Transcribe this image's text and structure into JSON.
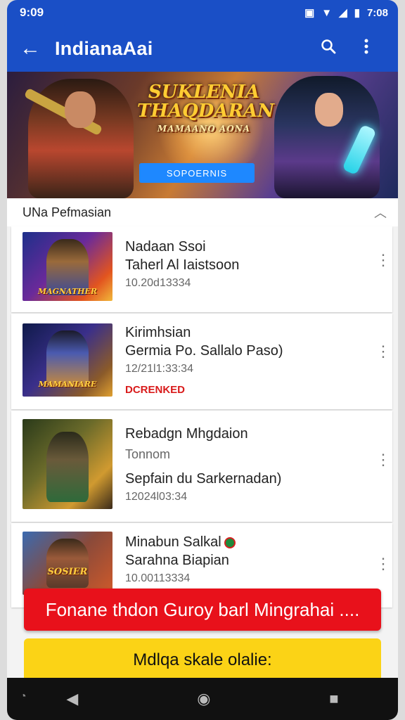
{
  "status_bar": {
    "time_left": "9:09",
    "time_right": "7:08",
    "icons": [
      "sim-icon",
      "wifi-icon",
      "signal-icon",
      "battery-icon"
    ]
  },
  "app_bar": {
    "title": "IndianaAai",
    "back_icon": "arrow-left-icon",
    "search_icon": "search-icon",
    "menu_icon": "more-vert-icon"
  },
  "banner": {
    "title_line1": "SUKLENIA",
    "title_line2": "THAQDARAN",
    "title_line3": "MAMAANO AONA",
    "button_label": "SOPOERNIS"
  },
  "section": {
    "title": "UNa Pefmasian",
    "chevron_icon": "chevron-up-icon"
  },
  "items": [
    {
      "title": "Nadaan Ssoi",
      "subtitle": "Taherl Al Iaistsoon",
      "date": "10.20d13334",
      "badge": "",
      "thumb_label": "MAGNATHER"
    },
    {
      "title": "Kirimhsian",
      "subtitle": "Germia Po. Sallalo Paso)",
      "date": "12/21l1:33:34",
      "badge": "DCRENKED",
      "thumb_label": "MAMANIARE"
    },
    {
      "title": "Rebadgn Mhgdaion",
      "subtitle": "Tonnom",
      "extra": "Sepfain du Sarkernadan)",
      "date": "12024l03:34",
      "badge": "",
      "thumb_label": ""
    },
    {
      "title": "Minabun Salkal",
      "subtitle": "Sarahna Biapian",
      "date": "10.00113334",
      "badge": "",
      "thumb_label": "SOSIER"
    }
  ],
  "cta": {
    "red_label": "Fonane thdon Guroy barl Mingrahai ....",
    "yellow_label": "Mdlqa skale olalie:"
  },
  "nav": {
    "back": "nav-back-icon",
    "home": "nav-home-icon",
    "recents": "nav-recents-icon"
  },
  "colors": {
    "primary": "#1a4fc6",
    "red": "#e8111b",
    "yellow": "#fbd316",
    "badge_red": "#d91b1b"
  }
}
